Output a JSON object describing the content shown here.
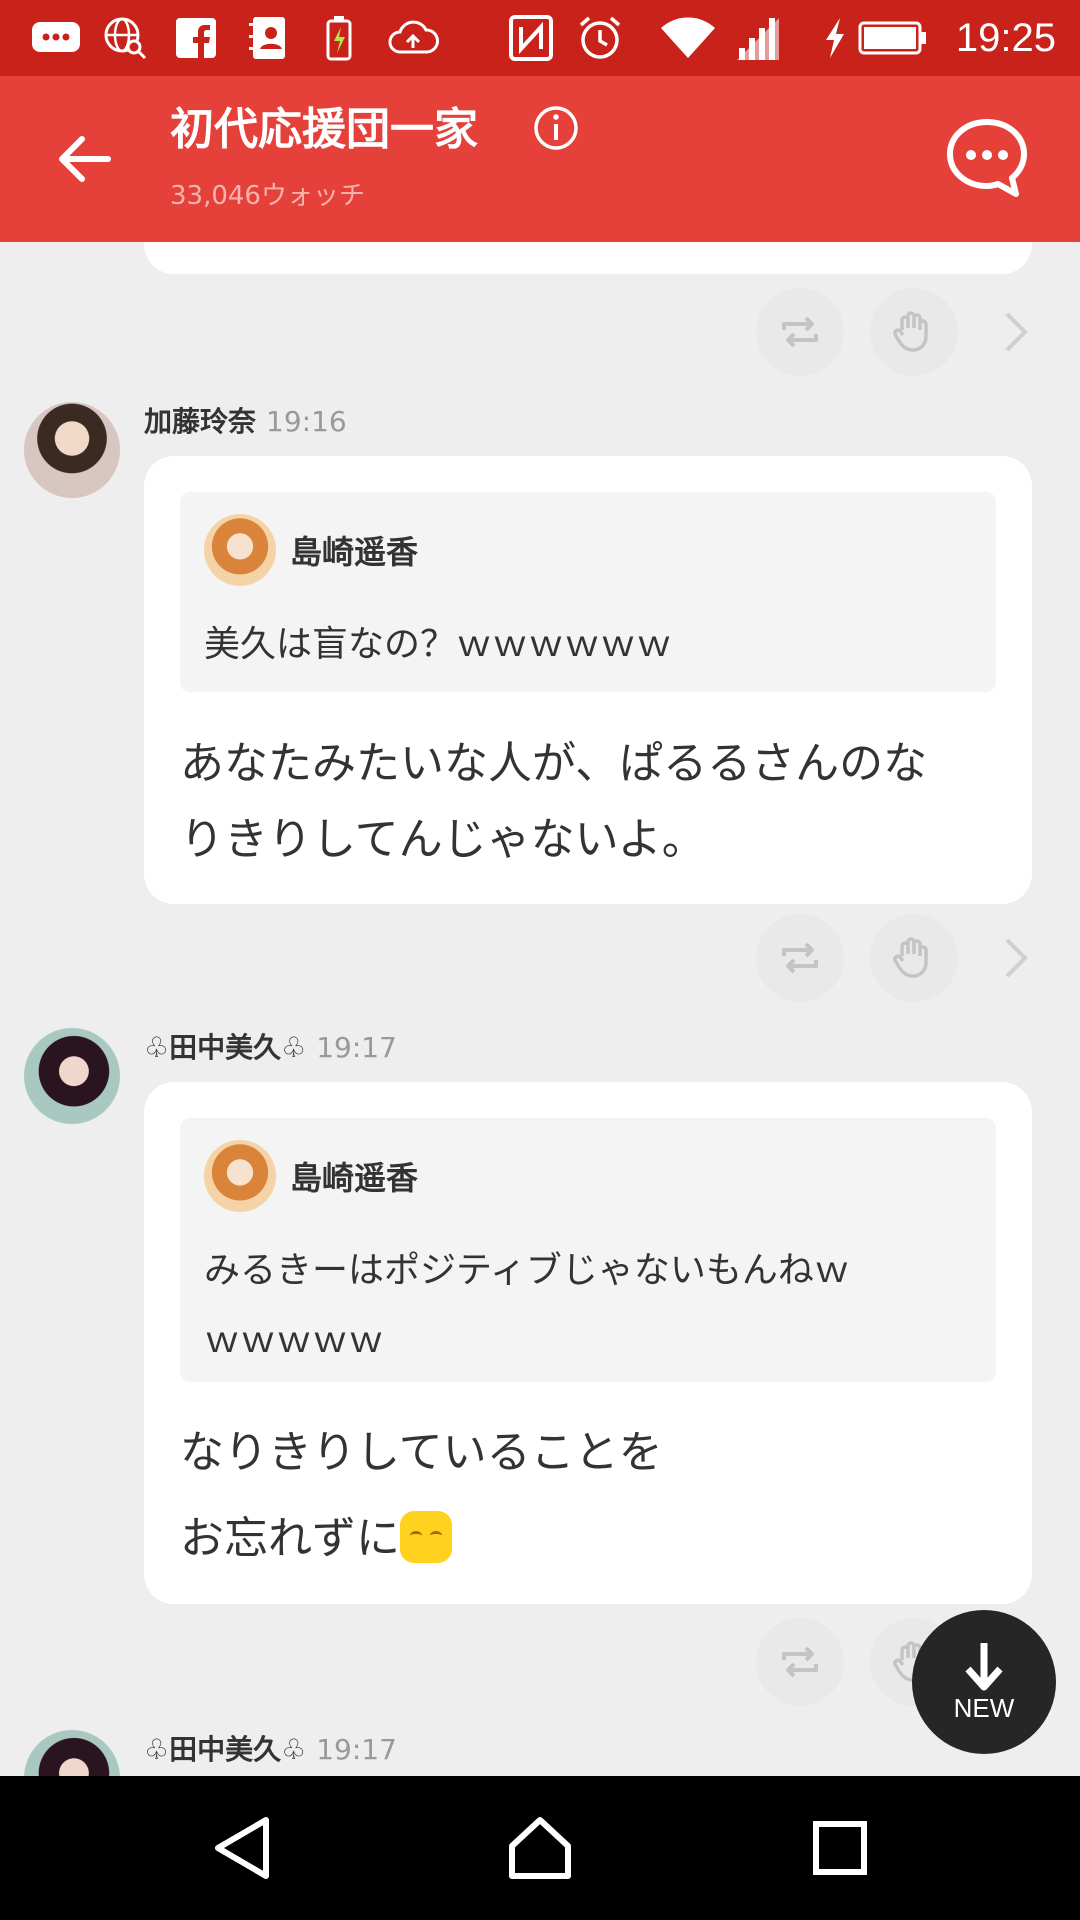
{
  "status_bar": {
    "time": "19:25",
    "icons": [
      "chat-bubble-icon",
      "web-search-icon",
      "facebook-icon",
      "contacts-icon",
      "battery-saver-icon",
      "cloud-upload-icon",
      "nfc-icon",
      "alarm-icon",
      "wifi-icon",
      "cell-signal-icon",
      "charging-icon",
      "battery-icon"
    ]
  },
  "header": {
    "title": "初代応援団一家",
    "watch_count": "33,046ウォッチ"
  },
  "posts": [
    {
      "author": "加藤玲奈",
      "time": "19:16",
      "quote_author": "島崎遥香",
      "quote_text": "美久は盲なの？ｗｗｗｗｗｗ",
      "body_line1": "あなたみたいな人が、ぱるるさんのな",
      "body_line2": "りきりしてんじゃないよ。"
    },
    {
      "author": "♧田中美久♧",
      "time": "19:17",
      "quote_author": "島崎遥香",
      "quote_line1": "みるきーはポジティブじゃないもんねｗ",
      "quote_line2": "ｗｗｗｗｗ",
      "body_line1": "なりきりしていることを",
      "body_line2": "お忘れずに"
    },
    {
      "author": "♧田中美久♧",
      "time": "19:17"
    }
  ],
  "fab": {
    "label": "NEW"
  },
  "colors": {
    "status_bar": "#c9221b",
    "app_bar": "#e5403a",
    "background": "#eeeeee"
  }
}
